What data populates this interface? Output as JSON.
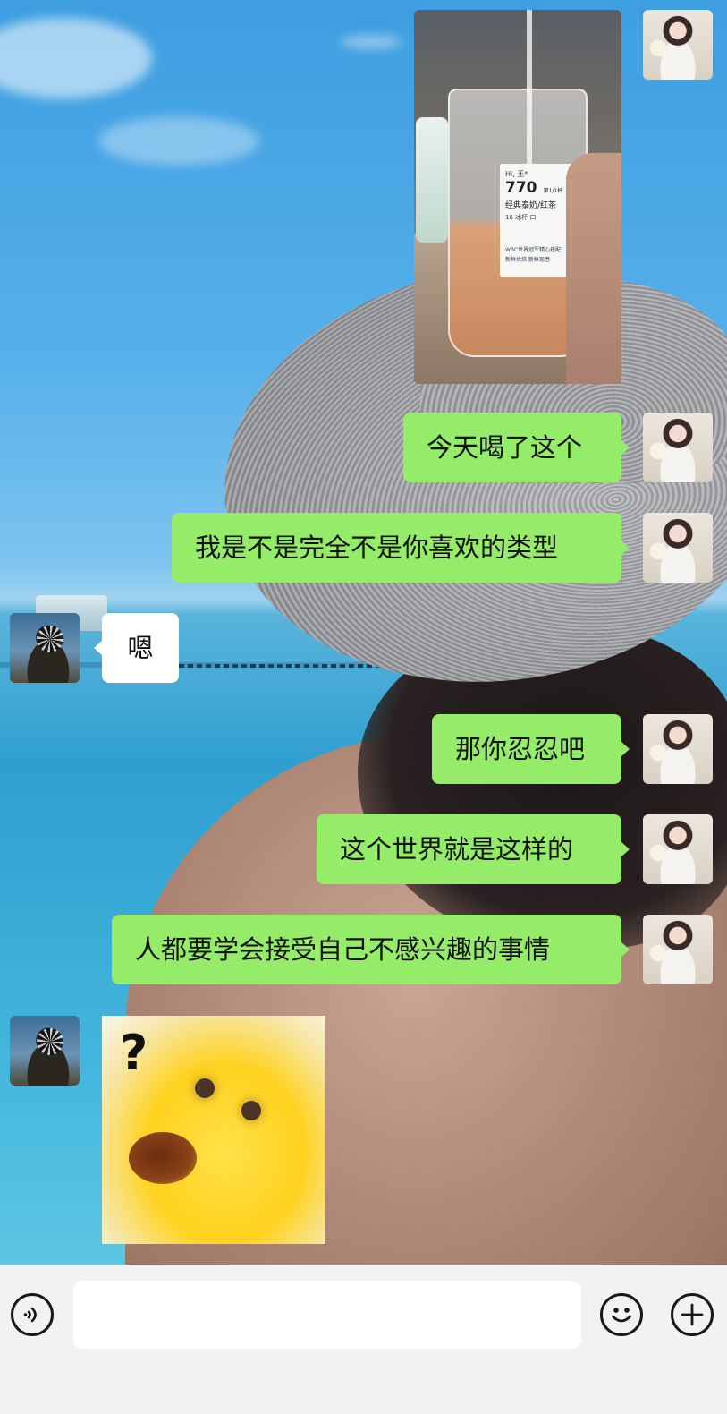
{
  "conversation": {
    "messages": [
      {
        "id": "m1",
        "sender": "me",
        "kind": "image"
      },
      {
        "id": "m2",
        "sender": "me",
        "kind": "text",
        "text": "今天喝了这个"
      },
      {
        "id": "m3",
        "sender": "me",
        "kind": "text",
        "text": "我是不是完全不是你喜欢的类型"
      },
      {
        "id": "m4",
        "sender": "other",
        "kind": "text",
        "text": "嗯"
      },
      {
        "id": "m5",
        "sender": "me",
        "kind": "text",
        "text": "那你忍忍吧"
      },
      {
        "id": "m6",
        "sender": "me",
        "kind": "text",
        "text": "这个世界就是这样的"
      },
      {
        "id": "m7",
        "sender": "me",
        "kind": "text",
        "text": "人都要学会接受自己不感兴趣的事情"
      },
      {
        "id": "m8",
        "sender": "other",
        "kind": "sticker",
        "text": "?"
      }
    ],
    "drink_label": {
      "greeting": "Hi, 王*",
      "order_number": "770",
      "count": "第1/1杯",
      "product": "经典泰奶/红茶",
      "spec": "16 冰杯 口",
      "brand_line": "WBC世界冠军精心搭配",
      "tagline": "新鲜烘焙 新鲜现磨"
    }
  },
  "input_bar": {
    "text_value": "",
    "icons": [
      "voice-icon",
      "emoji-icon",
      "add-icon"
    ]
  },
  "colors": {
    "outgoing_bubble": "#95ec69",
    "incoming_bubble": "#ffffff",
    "input_bar_bg": "#f2f2f2"
  }
}
